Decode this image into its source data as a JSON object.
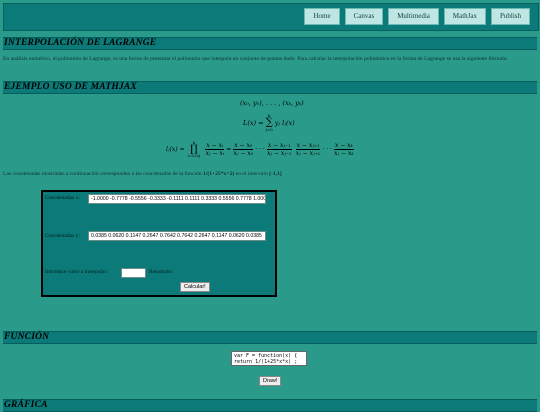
{
  "nav": {
    "items": [
      "Home",
      "Canvas",
      "Multimedia",
      "MathJax",
      "Publish"
    ]
  },
  "sections": {
    "interpolacion_title": "INTERPOLACIÓN DE LAGRANGE",
    "ejemplo_title": "EJEMPLO USO DE MATHJAX",
    "funcion_title": "FUNCIÓN",
    "grafica_title": "GRÁFICA"
  },
  "intro_text": "En análisis numérico, el polinomio de Lagrange, es una forma de presentar el polinomio que interpola un conjunto de puntos dado. Para calcular la interpolación polinómica en la forma de Lagrange se usa la siguiente fórmula:",
  "math": {
    "points": "(x₀, y₀), . . . , (xₖ, yₖ)",
    "L_lhs": "L(x) =",
    "L_sum": "∑",
    "L_sum_top": "k",
    "L_sum_bottom": "j=0",
    "L_term": "yⱼ lⱼ(x)",
    "l_lhs": "lⱼ(x) =",
    "l_prod": "∏",
    "l_prod_top": "k",
    "l_prod_bottom": "i=0,i≠j",
    "f1n": "x − xᵢ",
    "f1d": "xⱼ − xᵢ",
    "f2n": "x − x₀",
    "f2d": "xⱼ − x₀",
    "f3n": "x − xⱼ₋₁",
    "f3d": "xⱼ − xⱼ₋₁",
    "f4n": "x − xⱼ₊₁",
    "f4d": "xⱼ − xⱼ₊₁",
    "f5n": "x − xₖ",
    "f5d": "xⱼ − xₖ",
    "dots": "· · ·"
  },
  "coords_note_prefix": "Las coordenadas mostradas a continuación corresponden a las coordenadas de la función ",
  "coords_note_function": "1/(1+25*x^2)",
  "coords_note_middle": " en el intervalo ",
  "coords_note_interval": "[-1,1]",
  "panel": {
    "x_label": "Coordenadas x:",
    "x_value": "-1.0000 -0.7778 -0.5556 -0.3333 -0.1111 0.1111 0.3333 0.5556 0.7778 1.0000",
    "y_label": "Coordenadas y:",
    "y_value": "0.0385 0.0620 0.1147 0.2647 0.7642 0.7642 0.2647 0.1147 0.0620 0.0385",
    "interp_label": "Introduce valor a interpolar:",
    "interp_value": "",
    "result_label": "Resultado:",
    "calc_button": "Calcular!"
  },
  "function_code": {
    "line1": "var F = function(x) {",
    "line2": "return 1/(1+25*x*x) ;"
  },
  "draw_button": "Draw!"
}
